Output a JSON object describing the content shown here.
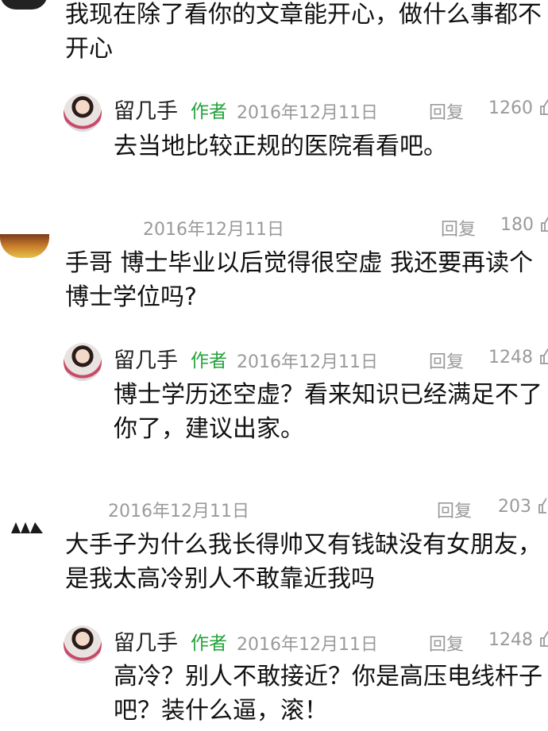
{
  "comments": [
    {
      "text": "我现在除了看你的文章能开心，做什么事都不开心",
      "reply": {
        "author": "留几手",
        "tag": "作者",
        "date": "2016年12月11日",
        "reply_label": "回复",
        "likes": "1260",
        "text": "去当地比较正规的医院看看吧。"
      }
    },
    {
      "date": "2016年12月11日",
      "reply_label": "回复",
      "likes": "180",
      "text": "手哥 博士毕业以后觉得很空虚 我还要再读个博士学位吗?",
      "reply": {
        "author": "留几手",
        "tag": "作者",
        "date": "2016年12月11日",
        "reply_label": "回复",
        "likes": "1248",
        "text": "博士学历还空虚？看来知识已经满足不了你了，建议出家。"
      }
    },
    {
      "date": "2016年12月11日",
      "reply_label": "回复",
      "likes": "203",
      "text": "大手子为什么我长得帅又有钱缺没有女朋友，是我太高冷别人不敢靠近我吗",
      "reply": {
        "author": "留几手",
        "tag": "作者",
        "date": "2016年12月11日",
        "reply_label": "回复",
        "likes": "1248",
        "text": "高冷？别人不敢接近？你是高压电线杆子吧？装什么逼，滚！"
      }
    }
  ]
}
